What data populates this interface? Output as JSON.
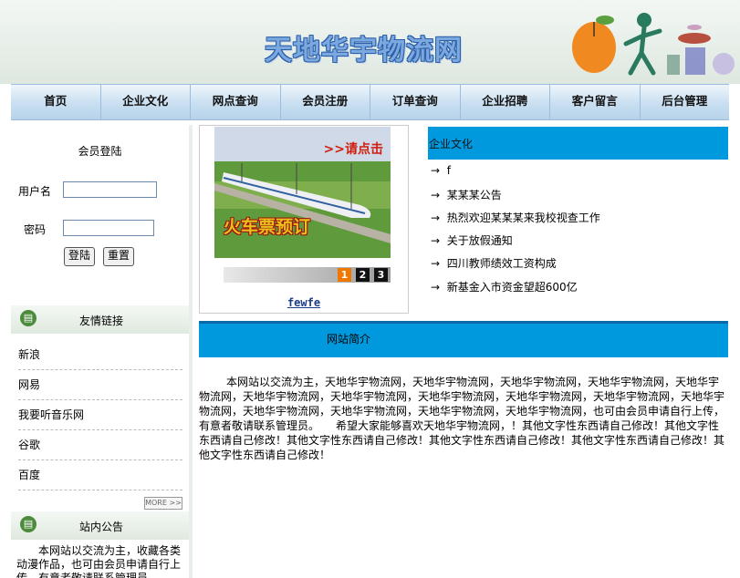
{
  "header": {
    "site_title": "天地华宇物流网"
  },
  "nav": [
    "首页",
    "企业文化",
    "网点查询",
    "会员注册",
    "订单查询",
    "企业招聘",
    "客户留言",
    "后台管理"
  ],
  "login": {
    "title": "会员登陆",
    "username_label": "用户名",
    "password_label": "密码",
    "login_button": "登陆",
    "reset_button": "重置"
  },
  "links": {
    "title": "友情链接",
    "items": [
      "新浪",
      "网易",
      "我要听音乐网",
      "谷歌",
      "百度"
    ],
    "more": "MORE >>"
  },
  "notice": {
    "title": "站内公告",
    "text": "本网站以交流为主，收藏各类动漫作品，也可由会员申请自行上传，有意者敬请联系管理员"
  },
  "slide": {
    "cta": ">>请点击",
    "banner_text": "火车票预订",
    "pages": [
      "1",
      "2",
      "3"
    ],
    "caption": "fewfe"
  },
  "news": {
    "title": "企业文化",
    "arrow": "→",
    "items": [
      "f",
      "某某某公告",
      "热烈欢迎某某某来我校视查工作",
      "关于放假通知",
      "四川教师绩效工资构成",
      "新基金入市资金望超600亿"
    ]
  },
  "intro": {
    "title": "网站简介",
    "text": "本网站以交流为主，天地华宇物流网，天地华宇物流网，天地华宇物流网，天地华宇物流网，天地华宇物流网，天地华宇物流网，天地华宇物流网，天地华宇物流网，天地华宇物流网，天地华宇物流网，天地华宇物流网，天地华宇物流网，天地华宇物流网，天地华宇物流网，天地华宇物流网，也可由会员申请自行上传，有意者敬请联系管理员。　　希望大家能够喜欢天地华宇物流网，！其他文字性东西请自己修改！其他文字性东西请自己修改！其他文字性东西请自己修改！其他文字性东西请自己修改！其他文字性东西请自己修改！其他文字性东西请自己修改！"
  },
  "colors": {
    "accent_blue": "#0099dd",
    "title_blue": "#2b5ea8"
  }
}
